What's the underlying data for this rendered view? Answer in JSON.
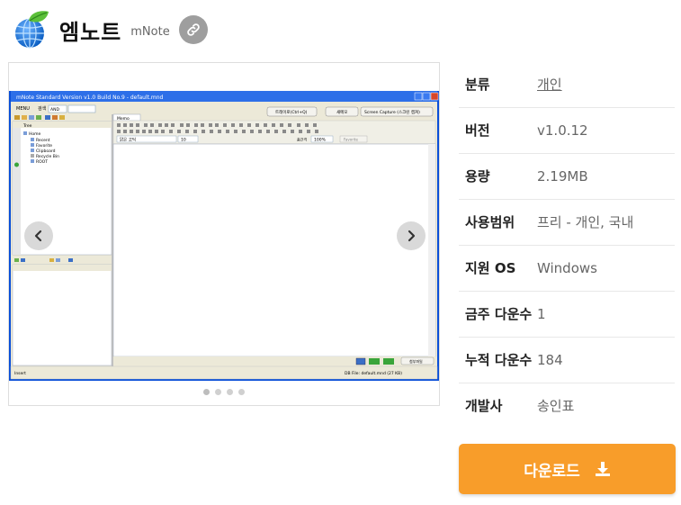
{
  "app": {
    "title": "엠노트",
    "subtitle": "mNote"
  },
  "screenshot": {
    "window_title": "mNote Standard Version v1.0 Build No.9 - default.mnd",
    "menu_label": "MENU",
    "search_label": "검색",
    "search_mode": "AND",
    "tree_header": "Tree",
    "tree_items": [
      "Home",
      "Recent",
      "Favorite",
      "Clipboard",
      "Recycle Bin",
      "ROOT"
    ],
    "tab_memo": "Memo",
    "font_name": "맑은 고딕",
    "font_size": "10",
    "zoom_label": "줌간격",
    "zoom_value": "100%",
    "favorite_label": "Favorite",
    "btn_shortcut": "트레이로(Ctrl+Q)",
    "btn_new": "새메모",
    "btn_capture": "Screen Capture (스크린 캡쳐)",
    "btn_attach": "첨부파일",
    "status_left": "Insert",
    "status_right": "DB File: default.mnd (27 KB)"
  },
  "gallery": {
    "dot_count": 4,
    "active_dot": 0
  },
  "info": [
    {
      "label": "분류",
      "value": "개인",
      "link": true
    },
    {
      "label": "버전",
      "value": "v1.0.12"
    },
    {
      "label": "용량",
      "value": "2.19MB"
    },
    {
      "label": "사용범위",
      "value": "프리 - 개인, 국내"
    },
    {
      "label": "지원 OS",
      "value": "Windows"
    },
    {
      "label": "금주 다운수",
      "value": "1"
    },
    {
      "label": "누적 다운수",
      "value": "184"
    },
    {
      "label": "개발사",
      "value": "송인표"
    }
  ],
  "download": {
    "label": "다운로드"
  },
  "colors": {
    "accent": "#f89d2a",
    "xp_blue": "#0a4fd8"
  },
  "icons": {
    "logo": "globe-leaf-icon",
    "link": "link-icon",
    "download": "download-icon",
    "prev": "chevron-left-icon",
    "next": "chevron-right-icon"
  }
}
